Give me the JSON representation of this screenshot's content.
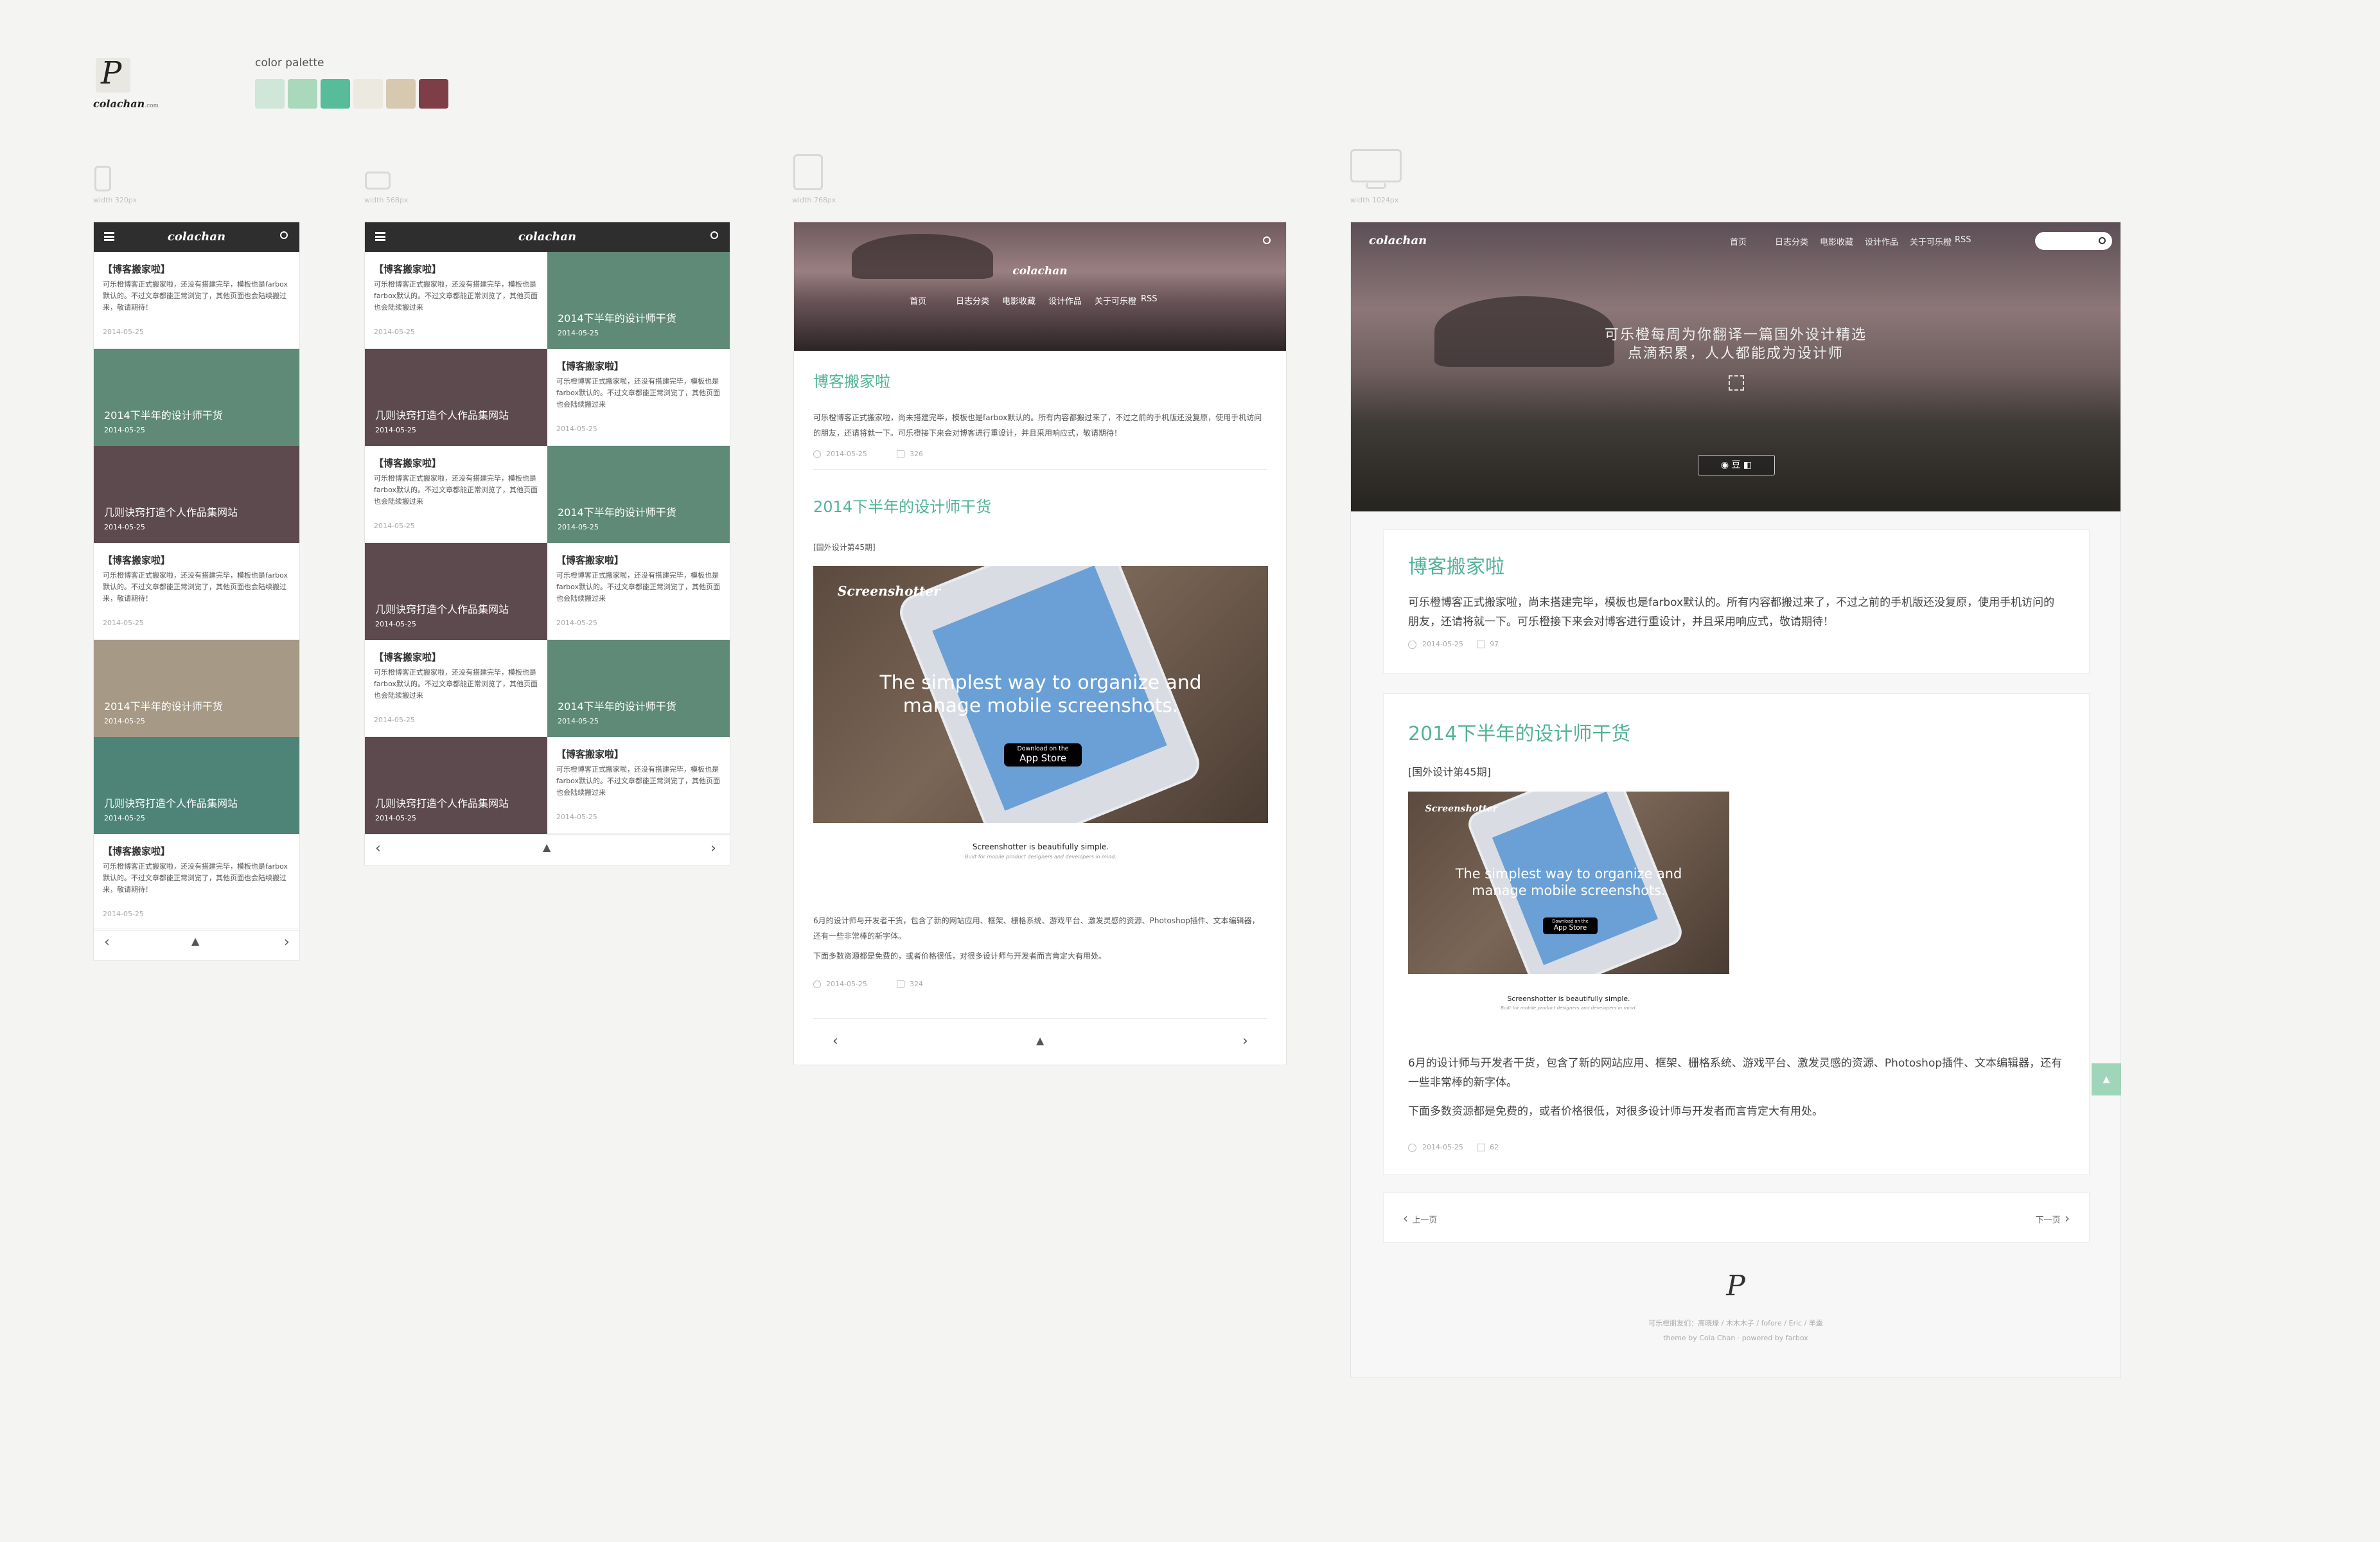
{
  "brand": {
    "logo_text": "colachan",
    "logo_suffix": ".com",
    "logo_glyph": "P"
  },
  "palette": {
    "label": "color palette",
    "colors": [
      "#cfe6d9",
      "#a9d8ba",
      "#58bb9a",
      "#ece9e0",
      "#d7c8b0",
      "#7d3e47"
    ]
  },
  "devices": {
    "mobile_label": "width 320px",
    "tablet_portrait_label": "width 568px",
    "tablet_label": "width 768px",
    "desktop_label": "width 1024px"
  },
  "mobile": {
    "site_name": "colachan",
    "items": [
      {
        "type": "text",
        "title": "【博客搬家啦】",
        "excerpt": "可乐橙博客正式搬家啦，还没有搭建完毕，模板也是farbox默认的。不过文章都能正常浏览了，其他页面也会陆续搬过来，敬请期待！",
        "date": "2014-05-25"
      },
      {
        "type": "tile",
        "title": "2014下半年的设计师干货",
        "date": "2014-05-25",
        "tone": "green"
      },
      {
        "type": "tile",
        "title": "几则诀窍打造个人作品集网站",
        "date": "2014-05-25",
        "tone": "maroon"
      },
      {
        "type": "text",
        "title": "【博客搬家啦】",
        "excerpt": "可乐橙博客正式搬家啦，还没有搭建完毕，模板也是farbox默认的。不过文章都能正常浏览了，其他页面也会陆续搬过来，敬请期待！",
        "date": "2014-05-25"
      },
      {
        "type": "tile",
        "title": "2014下半年的设计师干货",
        "date": "2014-05-25",
        "tone": "tan"
      },
      {
        "type": "tile",
        "title": "几则诀窍打造个人作品集网站",
        "date": "2014-05-25",
        "tone": "teal2"
      },
      {
        "type": "text",
        "title": "【博客搬家啦】",
        "excerpt": "可乐橙博客正式搬家啦，还没有搭建完毕，模板也是farbox默认的。不过文章都能正常浏览了，其他页面也会陆续搬过来，敬请期待！",
        "date": "2014-05-25"
      }
    ]
  },
  "tablet_portrait": {
    "site_name": "colachan",
    "rows": [
      {
        "left": {
          "type": "text",
          "title": "【博客搬家啦】",
          "excerpt": "可乐橙博客正式搬家啦，还没有搭建完毕，模板也是farbox默认的。不过文章都能正常浏览了，其他页面也会陆续搬过来",
          "date": "2014-05-25"
        },
        "right": {
          "type": "tile",
          "title": "2014下半年的设计师干货",
          "date": "2014-05-25",
          "tone": "green"
        }
      },
      {
        "left": {
          "type": "tile",
          "title": "几则诀窍打造个人作品集网站",
          "date": "2014-05-25",
          "tone": "maroon"
        },
        "right": {
          "type": "text",
          "title": "【博客搬家啦】",
          "excerpt": "可乐橙博客正式搬家啦，还没有搭建完毕，模板也是farbox默认的。不过文章都能正常浏览了，其他页面也会陆续搬过来",
          "date": "2014-05-25"
        }
      },
      {
        "left": {
          "type": "text",
          "title": "【博客搬家啦】",
          "excerpt": "可乐橙博客正式搬家啦，还没有搭建完毕，模板也是farbox默认的。不过文章都能正常浏览了，其他页面也会陆续搬过来",
          "date": "2014-05-25"
        },
        "right": {
          "type": "tile",
          "title": "2014下半年的设计师干货",
          "date": "2014-05-25",
          "tone": "green"
        }
      },
      {
        "left": {
          "type": "tile",
          "title": "几则诀窍打造个人作品集网站",
          "date": "2014-05-25",
          "tone": "maroon"
        },
        "right": {
          "type": "text",
          "title": "【博客搬家啦】",
          "excerpt": "可乐橙博客正式搬家啦，还没有搭建完毕，模板也是farbox默认的。不过文章都能正常浏览了，其他页面也会陆续搬过来",
          "date": "2014-05-25"
        }
      },
      {
        "left": {
          "type": "text",
          "title": "【博客搬家啦】",
          "excerpt": "可乐橙博客正式搬家啦，还没有搭建完毕，模板也是farbox默认的。不过文章都能正常浏览了，其他页面也会陆续搬过来",
          "date": "2014-05-25"
        },
        "right": {
          "type": "tile",
          "title": "2014下半年的设计师干货",
          "date": "2014-05-25",
          "tone": "green"
        }
      },
      {
        "left": {
          "type": "tile",
          "title": "几则诀窍打造个人作品集网站",
          "date": "2014-05-25",
          "tone": "maroon"
        },
        "right": {
          "type": "text",
          "title": "【博客搬家啦】",
          "excerpt": "可乐橙博客正式搬家啦，还没有搭建完毕，模板也是farbox默认的。不过文章都能正常浏览了，其他页面也会陆续搬过来",
          "date": "2014-05-25"
        }
      }
    ]
  },
  "tablet": {
    "site_name": "colachan",
    "nav": [
      "首页",
      "日志分类",
      "电影收藏",
      "设计作品",
      "关于可乐橙",
      "RSS"
    ],
    "post1": {
      "title": "博客搬家啦",
      "body": "可乐橙博客正式搬家啦，尚未搭建完毕，模板也是farbox默认的。所有内容都搬过来了，不过之前的手机版还没复原，使用手机访问的朋友，还请将就一下。可乐橙接下来会对博客进行重设计，并且采用响应式，敬请期待！",
      "date": "2014-05-25",
      "count": "326"
    },
    "post2": {
      "title": "2014下半年的设计师干货",
      "tag": "[国外设计第45期]",
      "body1": "6月的设计师与开发者干货，包含了新的网站应用、框架、栅格系统、游戏平台、激发灵感的资源、Photoshop插件、文本编辑器，还有一些非常棒的新字体。",
      "body2": "下面多数资源都是免费的，或者价格很低，对很多设计师与开发者而言肯定大有用处。",
      "date": "2014-05-25",
      "count": "324"
    }
  },
  "desktop": {
    "site_name": "colachan",
    "nav": [
      "首页",
      "日志分类",
      "电影收藏",
      "设计作品",
      "关于可乐橙",
      "RSS"
    ],
    "hero_line1": "可乐橙每周为你翻译一篇国外设计精选",
    "hero_line2": "点滴积累，人人都能成为设计师",
    "hero_btn": "豆",
    "post1": {
      "title": "博客搬家啦",
      "body": "可乐橙博客正式搬家啦，尚未搭建完毕，模板也是farbox默认的。所有内容都搬过来了，不过之前的手机版还没复原，使用手机访问的朋友，还请将就一下。可乐橙接下来会对博客进行重设计，并且采用响应式，敬请期待！",
      "date": "2014-05-25",
      "count": "97"
    },
    "post2": {
      "title": "2014下半年的设计师干货",
      "tag": "[国外设计第45期]",
      "body1": "6月的设计师与开发者干货，包含了新的网站应用、框架、栅格系统、游戏平台、激发灵感的资源、Photoshop插件、文本编辑器，还有一些非常棒的新字体。",
      "body2": "下面多数资源都是免费的，或者价格很低，对很多设计师与开发者而言肯定大有用处。",
      "date": "2014-05-25",
      "count": "62"
    },
    "prev_label": "上一页",
    "next_label": "下一页",
    "footer_line1": "可乐橙朋友们：高晓烽 / 木木木子 / fofore / Eric / 羊羹",
    "footer_line2": "theme by Cola Chan · powered by farbox"
  },
  "promo": {
    "brand": "Screenshotter",
    "headline_1": "The simplest way to organize and",
    "headline_2": "manage mobile screenshots.",
    "store": "App Store",
    "store_small": "Download on the",
    "caption": "Screenshotter is beautifully simple.",
    "subcaption": "Built for mobile product designers and developers in mind."
  },
  "icons": [
    "menu-icon",
    "search-icon",
    "chevron-left-icon",
    "chevron-right-icon",
    "arrow-up-icon",
    "clock-icon",
    "comment-icon",
    "weibo-icon",
    "qr-icon"
  ]
}
